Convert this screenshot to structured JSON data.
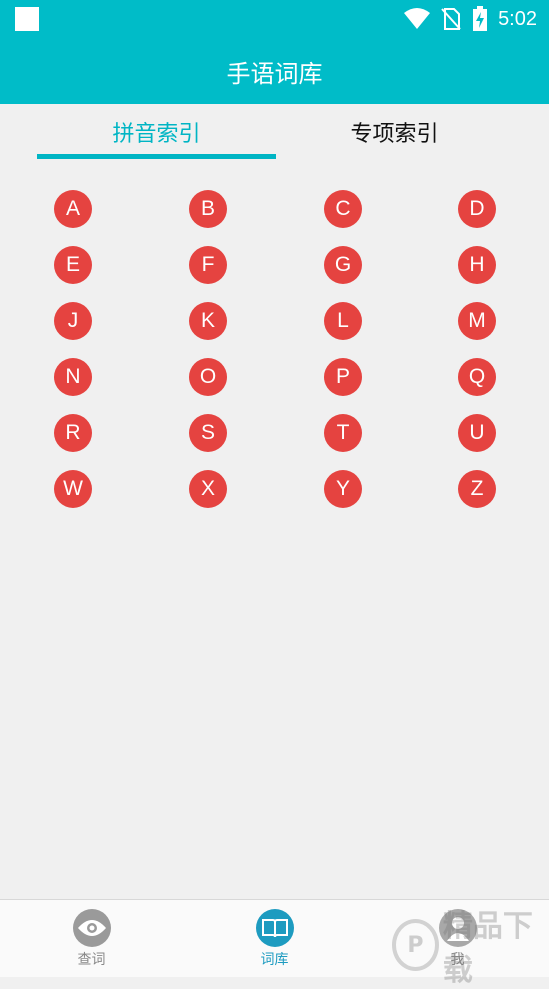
{
  "status_bar": {
    "time": "5:02"
  },
  "header": {
    "title": "手语词库"
  },
  "tabs": [
    {
      "label": "拼音索引",
      "active": true
    },
    {
      "label": "专项索引",
      "active": false
    }
  ],
  "letters": [
    "A",
    "B",
    "C",
    "D",
    "E",
    "F",
    "G",
    "H",
    "J",
    "K",
    "L",
    "M",
    "N",
    "O",
    "P",
    "Q",
    "R",
    "S",
    "T",
    "U",
    "W",
    "X",
    "Y",
    "Z"
  ],
  "bottom_nav": [
    {
      "label": "查词",
      "icon": "eye-icon",
      "active": false
    },
    {
      "label": "词库",
      "icon": "book-icon",
      "active": true
    },
    {
      "label": "我",
      "icon": "person-icon",
      "active": false
    }
  ],
  "watermark": {
    "text": "精品下载"
  },
  "colors": {
    "primary": "#00bcc8",
    "tab_active": "#00b5c4",
    "letter_bg": "#e54340",
    "nav_active": "#1d9bc0"
  }
}
